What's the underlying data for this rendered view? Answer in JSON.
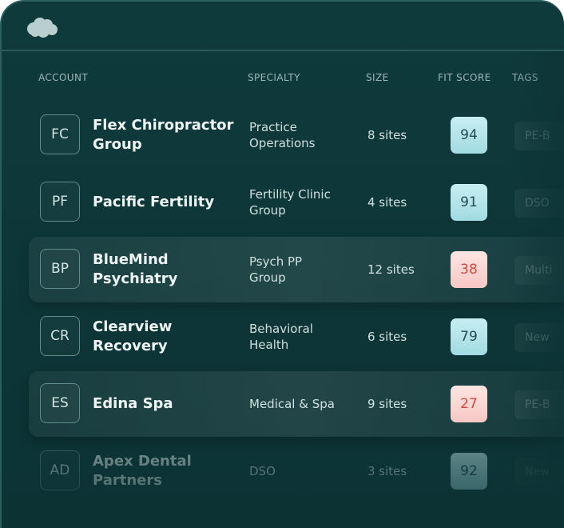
{
  "header": {
    "logo_icon": "cloud-logo-icon",
    "columns": {
      "account": "ACCOUNT",
      "specialty": "SPECIALTY",
      "size": "SIZE",
      "fit_score": "FIT SCORE",
      "tags": "TAGS"
    }
  },
  "rows": [
    {
      "initials": "FC",
      "name": "Flex Chiropractor\nGroup",
      "specialty": "Practice\nOperations",
      "size": "8 sites",
      "fit_score": "94",
      "tag": "PE-B"
    },
    {
      "initials": "PF",
      "name": "Pacific Fertility",
      "specialty": "Fertility Clinic\nGroup",
      "size": "4 sites",
      "fit_score": "91",
      "tag": "DSO"
    },
    {
      "initials": "BP",
      "name": "BlueMind\nPsychiatry",
      "specialty": "Psych PP\nGroup",
      "size": "12 sites",
      "fit_score": "38",
      "tag": "Multi"
    },
    {
      "initials": "CR",
      "name": "Clearview\nRecovery",
      "specialty": "Behavioral\nHealth",
      "size": "6 sites",
      "fit_score": "79",
      "tag": "New"
    },
    {
      "initials": "ES",
      "name": "Edina Spa",
      "specialty": "Medical & Spa",
      "size": "9 sites",
      "fit_score": "27",
      "tag": "PE-B"
    },
    {
      "initials": "AD",
      "name": "Apex Dental\nPartners",
      "specialty": "DSO",
      "size": "3 sites",
      "fit_score": "92",
      "tag": "New"
    }
  ],
  "colors": {
    "background": "#0f3a3c",
    "score_good": "#a2dbe2",
    "score_bad": "#f6c8c4",
    "score_bad_text": "#d14a40"
  }
}
